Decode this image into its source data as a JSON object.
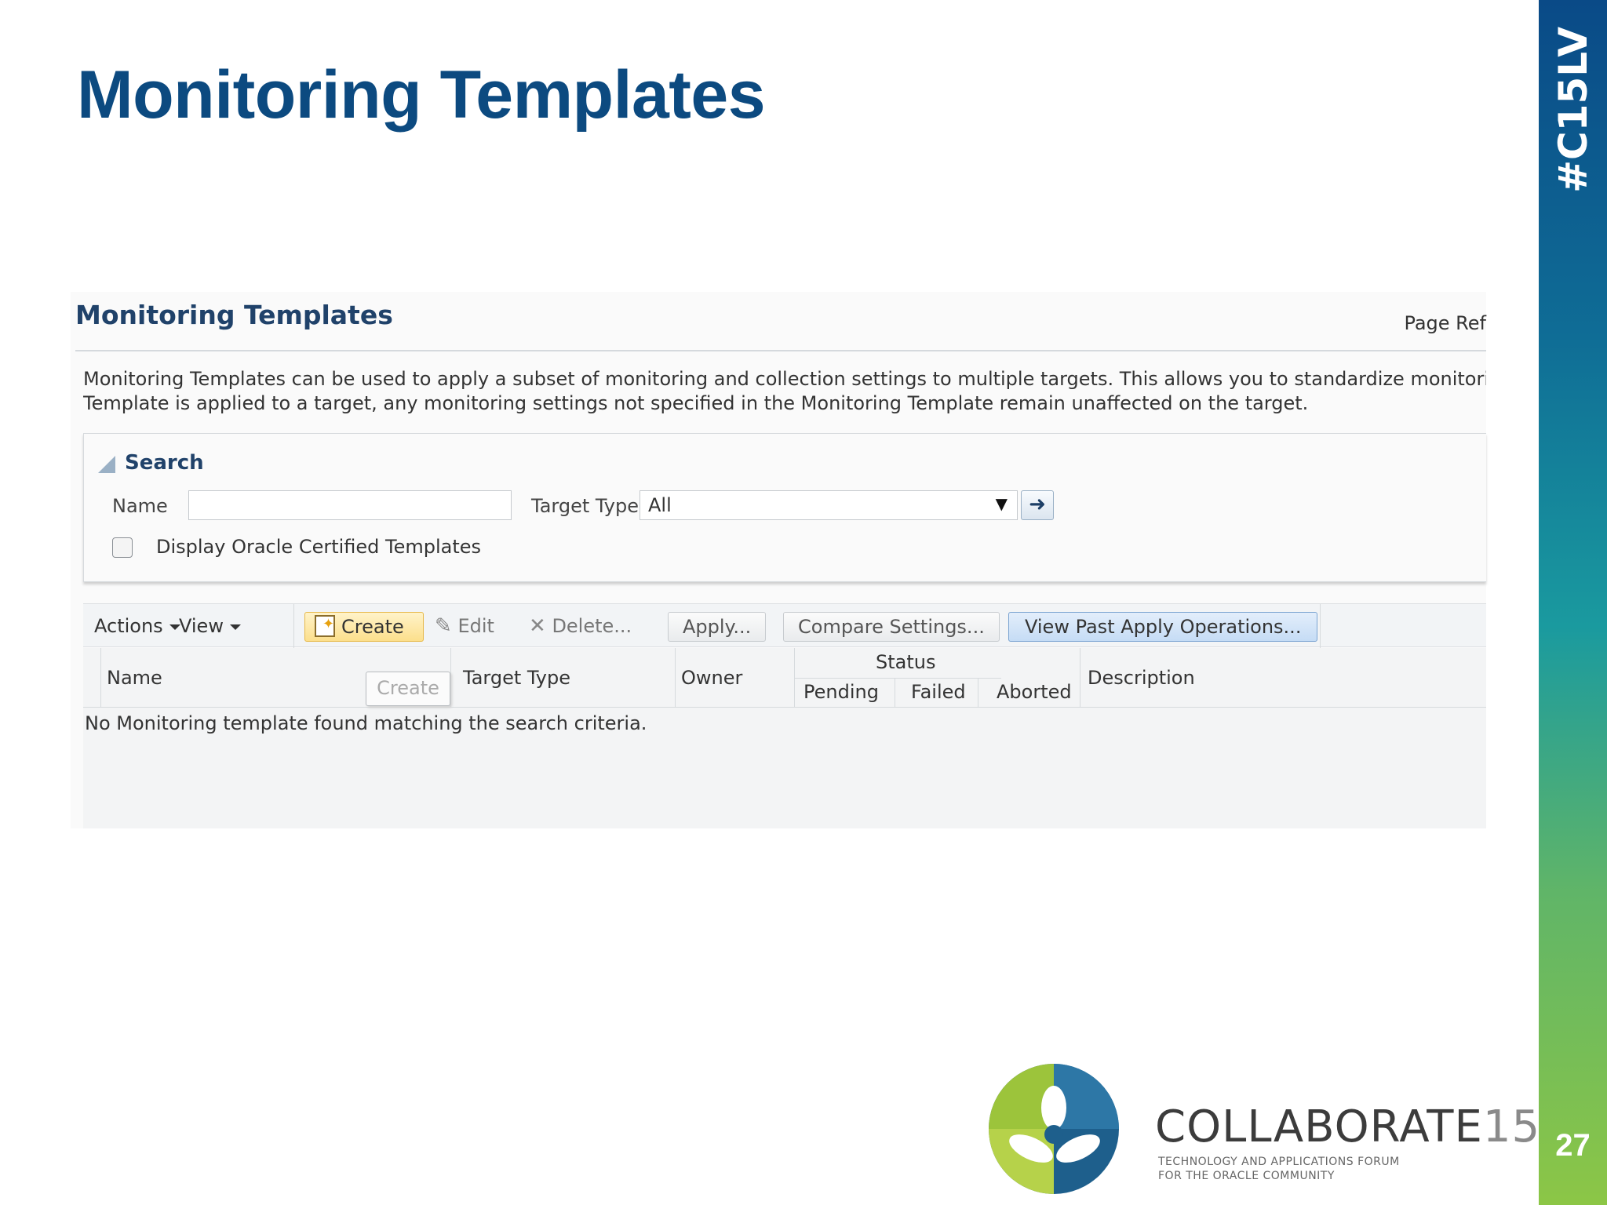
{
  "slide": {
    "title": "Monitoring Templates",
    "hashtag": "#C15LV",
    "page_number": "27",
    "logo": {
      "name": "COLLABORATE",
      "number": "15",
      "tagline_1": "TECHNOLOGY AND APPLICATIONS FORUM",
      "tagline_2": "FOR THE ORACLE COMMUNITY"
    },
    "colors": {
      "title": "#0c4a80",
      "sidebar_top": "#0a4a87",
      "sidebar_bottom": "#8cc646"
    }
  },
  "screenshot": {
    "title": "Monitoring Templates",
    "page_ref": "Page Ref",
    "description_1": "Monitoring Templates can be used to apply a subset of monitoring and collection settings to multiple targets. This allows you to standardize monitoring acros",
    "description_2": "Template is applied to a target, any monitoring settings not specified in the Monitoring Template remain unaffected on the target.",
    "search": {
      "label": "Search",
      "name_label": "Name",
      "name_value": "",
      "target_type_label": "Target Type",
      "target_type_value": "All",
      "certified_label": "Display Oracle Certified Templates"
    },
    "toolbar": {
      "actions": "Actions",
      "view": "View",
      "create": "Create",
      "edit": "Edit",
      "delete": "Delete...",
      "apply": "Apply...",
      "compare": "Compare Settings...",
      "view_past": "View Past Apply Operations..."
    },
    "table": {
      "columns": {
        "name": "Name",
        "target_type": "Target Type",
        "owner": "Owner",
        "status": "Status",
        "pending": "Pending",
        "failed": "Failed",
        "aborted": "Aborted",
        "description": "Description"
      },
      "tooltip": "Create",
      "empty_message": "No Monitoring template found matching the search criteria."
    }
  }
}
